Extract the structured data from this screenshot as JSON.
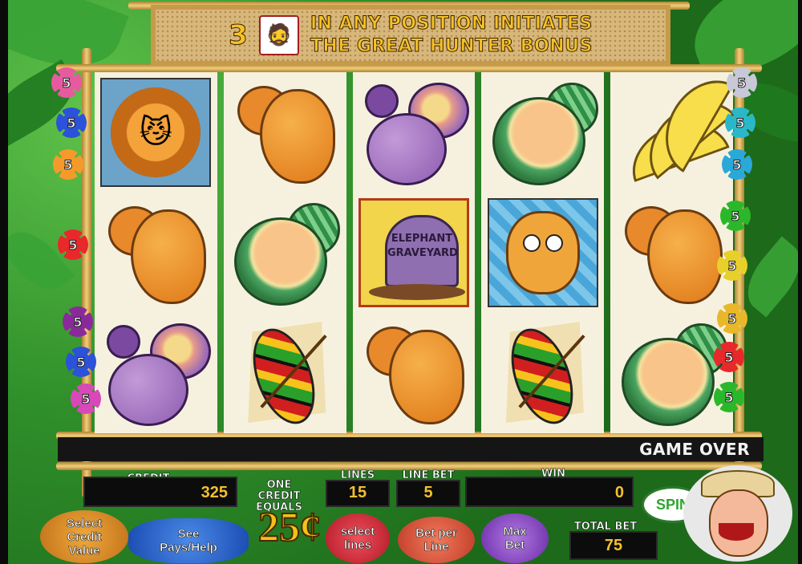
{
  "banner": {
    "count": "3",
    "line1": "IN ANY POSITION INITIATES",
    "line2": "THE GREAT HUNTER BONUS",
    "icon": "great-hunter-icon"
  },
  "reels": [
    [
      "lion",
      "mango",
      "plum"
    ],
    [
      "mango",
      "melon",
      "shield"
    ],
    [
      "plum",
      "elephant-graveyard",
      "mango"
    ],
    [
      "melon",
      "giraffe",
      "shield"
    ],
    [
      "banana",
      "mango",
      "melon"
    ]
  ],
  "graveyard_text": [
    "ELEPHANT",
    "GRAVEYARD"
  ],
  "left_lines": [
    {
      "label": "5",
      "color": "#e85aa0"
    },
    {
      "label": "5",
      "color": "#2b52d8"
    },
    {
      "label": "5",
      "color": "#f59a2a"
    },
    {
      "label": "5",
      "color": "#e8282a"
    },
    {
      "label": "5",
      "color": "#8a2a9a"
    },
    {
      "label": "5",
      "color": "#2b52d8"
    },
    {
      "label": "5",
      "color": "#d848b8"
    }
  ],
  "right_lines": [
    {
      "label": "5",
      "color": "#c8c8d8"
    },
    {
      "label": "5",
      "color": "#2ab8c8"
    },
    {
      "label": "5",
      "color": "#2aa8d8"
    },
    {
      "label": "5",
      "color": "#2ab82a"
    },
    {
      "label": "5",
      "color": "#e8d02a"
    },
    {
      "label": "5",
      "color": "#e8b82a"
    },
    {
      "label": "5",
      "color": "#e8282a"
    },
    {
      "label": "5",
      "color": "#2ab82a"
    }
  ],
  "status": {
    "message": "GAME OVER"
  },
  "meters": {
    "credit_label": "CREDIT",
    "credit_value": "325",
    "one_credit_label_1": "ONE CREDIT",
    "one_credit_label_2": "EQUALS",
    "lines_label": "LINES",
    "lines_value": "15",
    "line_bet_label": "LINE BET",
    "line_bet_value": "5",
    "win_label": "WIN",
    "win_value": "0",
    "total_bet_label": "TOTAL BET",
    "total_bet_value": "75"
  },
  "buttons": {
    "select_credit_1": "Select",
    "select_credit_2": "Credit",
    "select_credit_3": "Value",
    "see_pays_1": "See",
    "see_pays_2": "Pays/Help",
    "denomination": "25¢",
    "select_lines_1": "select",
    "select_lines_2": "lines",
    "bet_per_line_1": "Bet per",
    "bet_per_line_2": "Line",
    "max_bet_1": "Max",
    "max_bet_2": "Bet",
    "spin": "SPIN"
  }
}
